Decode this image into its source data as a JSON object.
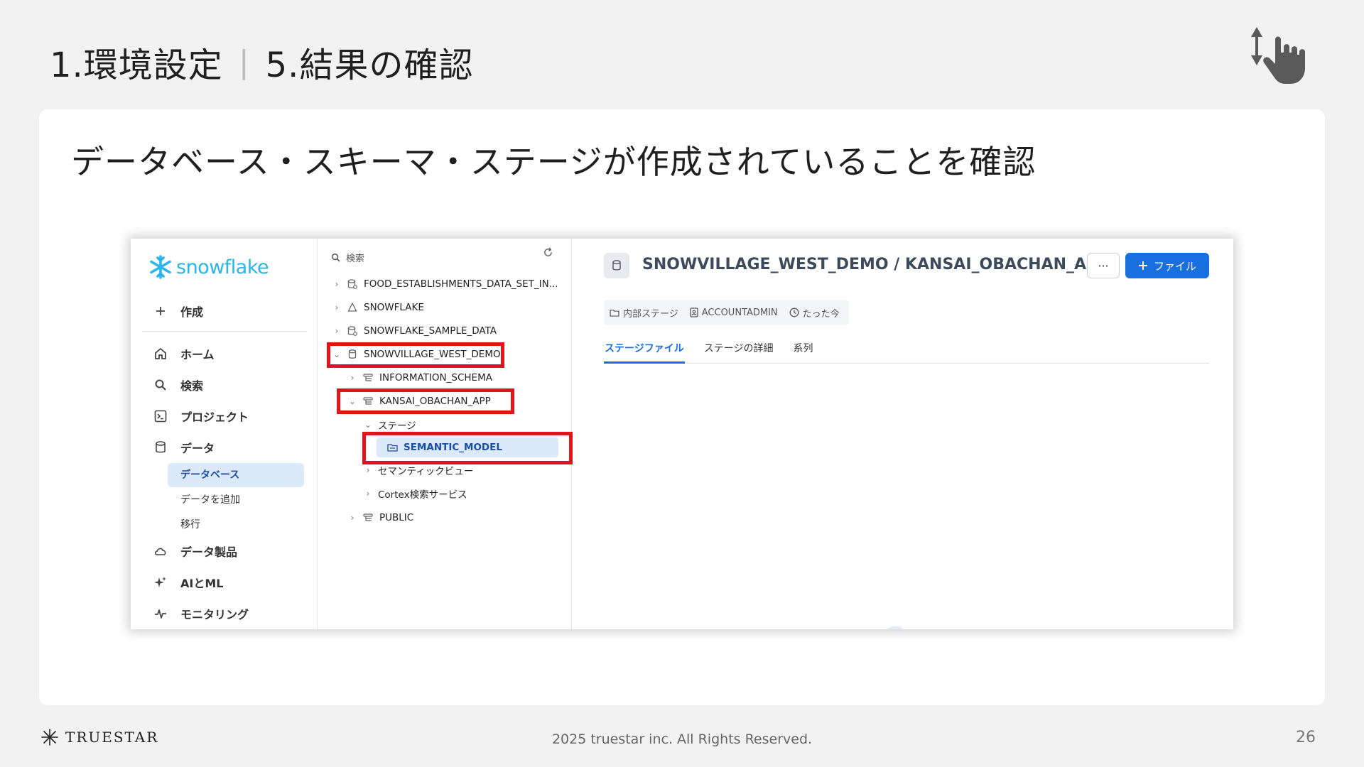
{
  "slide": {
    "title_left": "1.環境設定",
    "title_sep": "|",
    "title_right": "5.結果の確認",
    "subtitle": "データベース・スキーマ・ステージが作成されていることを確認",
    "footer_brand": "TRUESTAR",
    "copyright": "2025 truestar inc. All Rights Reserved.",
    "page_number": "26"
  },
  "nav": {
    "logo": "snowflake",
    "create": "作成",
    "items": [
      {
        "label": "ホーム",
        "icon": "home-icon"
      },
      {
        "label": "検索",
        "icon": "search-icon"
      },
      {
        "label": "プロジェクト",
        "icon": "terminal-icon"
      },
      {
        "label": "データ",
        "icon": "database-icon"
      }
    ],
    "data_subitems": [
      "データベース",
      "データを追加",
      "移行"
    ],
    "more_items": [
      {
        "label": "データ製品",
        "icon": "cloud-icon"
      },
      {
        "label": "AIとML",
        "icon": "sparkle-icon"
      },
      {
        "label": "モニタリング",
        "icon": "pulse-icon"
      }
    ]
  },
  "tree": {
    "search_placeholder": "検索",
    "rows": [
      "FOOD_ESTABLISHMENTS_DATA_SET_IN...",
      "SNOWFLAKE",
      "SNOWFLAKE_SAMPLE_DATA",
      "SNOWVILLAGE_WEST_DEMO",
      "INFORMATION_SCHEMA",
      "KANSAI_OBACHAN_APP",
      "ステージ",
      "SEMANTIC_MODEL",
      "セマンティックビュー",
      "Cortex検索サービス",
      "PUBLIC"
    ]
  },
  "main": {
    "path_title": "SNOWVILLAGE_WEST_DEMO / KANSAI_OBACHAN_APP / SEMANTIC_MODEL",
    "more_label": "···",
    "file_button": "ファイル",
    "meta": [
      "内部ステージ",
      "ACCOUNTADMIN",
      "たった今"
    ],
    "tabs": [
      "ステージファイル",
      "ステージの詳細",
      "系列"
    ]
  },
  "colors": {
    "highlight": "#e0141a",
    "accent": "#1a6fe0",
    "snowflake_brand": "#29b5e8"
  }
}
